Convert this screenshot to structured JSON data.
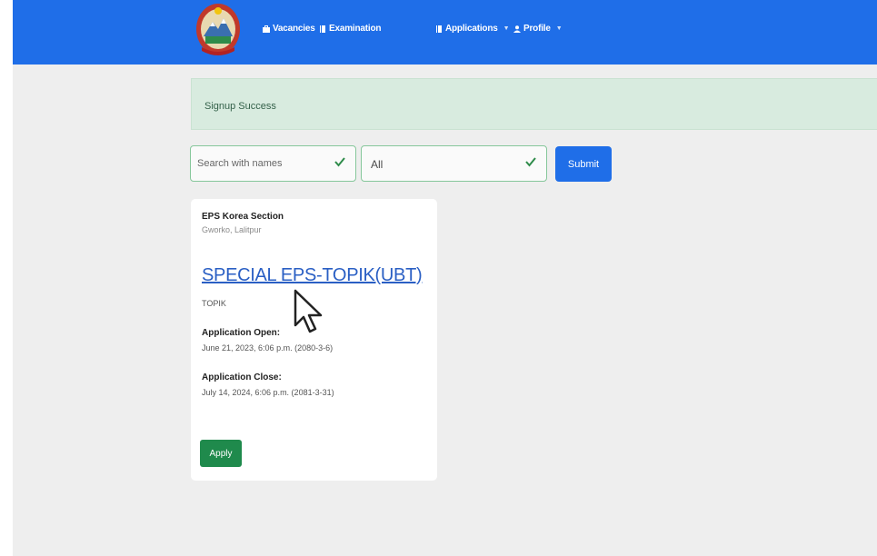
{
  "navbar": {
    "color": "#1f6ee8",
    "logo_icon": "nepal-emblem-icon",
    "items": [
      {
        "label": "Vacancies",
        "icon": "briefcase-icon"
      },
      {
        "label": "Examination",
        "icon": "book-icon"
      },
      {
        "label": "Applications",
        "icon": "book-icon"
      },
      {
        "label": "Profile",
        "icon": "user-icon"
      }
    ]
  },
  "alert": {
    "message": "Signup Success",
    "color": "#d8ebdf"
  },
  "filters": {
    "search_placeholder": "Search with names",
    "select_value": "All",
    "submit_label": "Submit"
  },
  "card": {
    "organization": "EPS Korea Section",
    "location": "Gworko, Lalitpur",
    "title": "SPECIAL EPS-TOPIK(UBT)",
    "category": "TOPIK",
    "open_label": "Application Open:",
    "open_date": "June 21, 2023, 6:06 p.m. (2080-3-6)",
    "close_label": "Application Close:",
    "close_date": "July 14, 2024, 6:06 p.m. (2081-3-31)",
    "apply_label": "Apply",
    "apply_color": "#1f8a4c"
  }
}
